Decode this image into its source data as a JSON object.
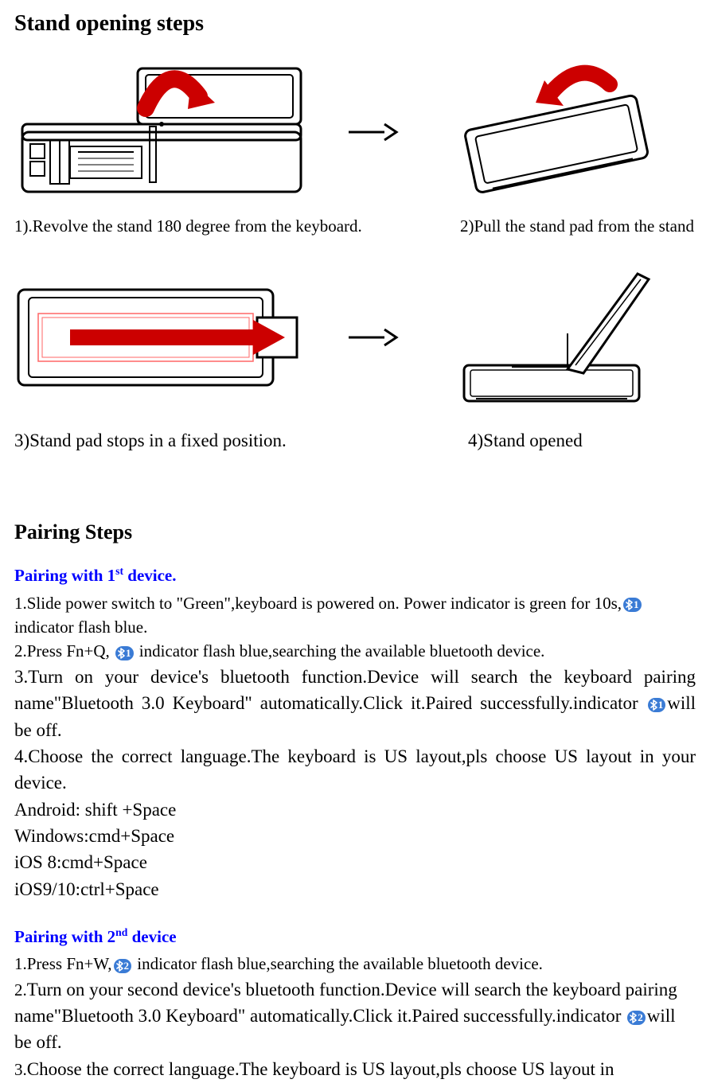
{
  "heading1": "Stand opening steps",
  "captions": {
    "step1": "1).Revolve the stand 180 degree from the keyboard.",
    "step2": "2)Pull the stand pad from the stand",
    "step3": "3)Stand pad stops in a fixed position.",
    "step4": "4)Stand opened"
  },
  "heading2": "Pairing Steps",
  "pair1": {
    "title_pre": "Pairing with 1",
    "title_sup": "st",
    "title_post": " device.",
    "s1a": "1.Slide power switch to \"Green\",keyboard is powered on. Power indicator is green for 10s,",
    "s1b": "indicator flash blue.",
    "s2a": "2.Press Fn+Q, ",
    "s2b": " indicator flash blue,searching the available bluetooth device.",
    "s3a": "3.Turn on your device's bluetooth function.Device will search the keyboard pairing name\"Bluetooth 3.0 Keyboard\" automatically.Click it.Paired successfully.indicator ",
    "s3b": "will be off.",
    "s4": "4.Choose the correct language.The keyboard is US layout,pls choose US layout in your device.",
    "android": "Android: shift +Space",
    "windows": "Windows:cmd+Space",
    "ios8": "iOS 8:cmd+Space",
    "ios910": "iOS9/10:ctrl+Space"
  },
  "pair2": {
    "title_pre": "Pairing with 2",
    "title_sup": "nd",
    "title_post": " device",
    "s1a": "1.Press Fn+W,",
    "s1b": " indicator flash blue,searching the available bluetooth device.",
    "s2a": "2.",
    "s2b": "Turn on your second device's bluetooth function.Device will search the keyboard pairing name\"Bluetooth 3.0 Keyboard\" automatically.Click it.Paired successfully.indicator ",
    "s2c": "will be off.",
    "s3a": "3.",
    "s3b": "Choose the correct language.The keyboard is US layout,pls choose US layout in"
  },
  "icons": {
    "bt1": "1",
    "bt2": "2"
  }
}
